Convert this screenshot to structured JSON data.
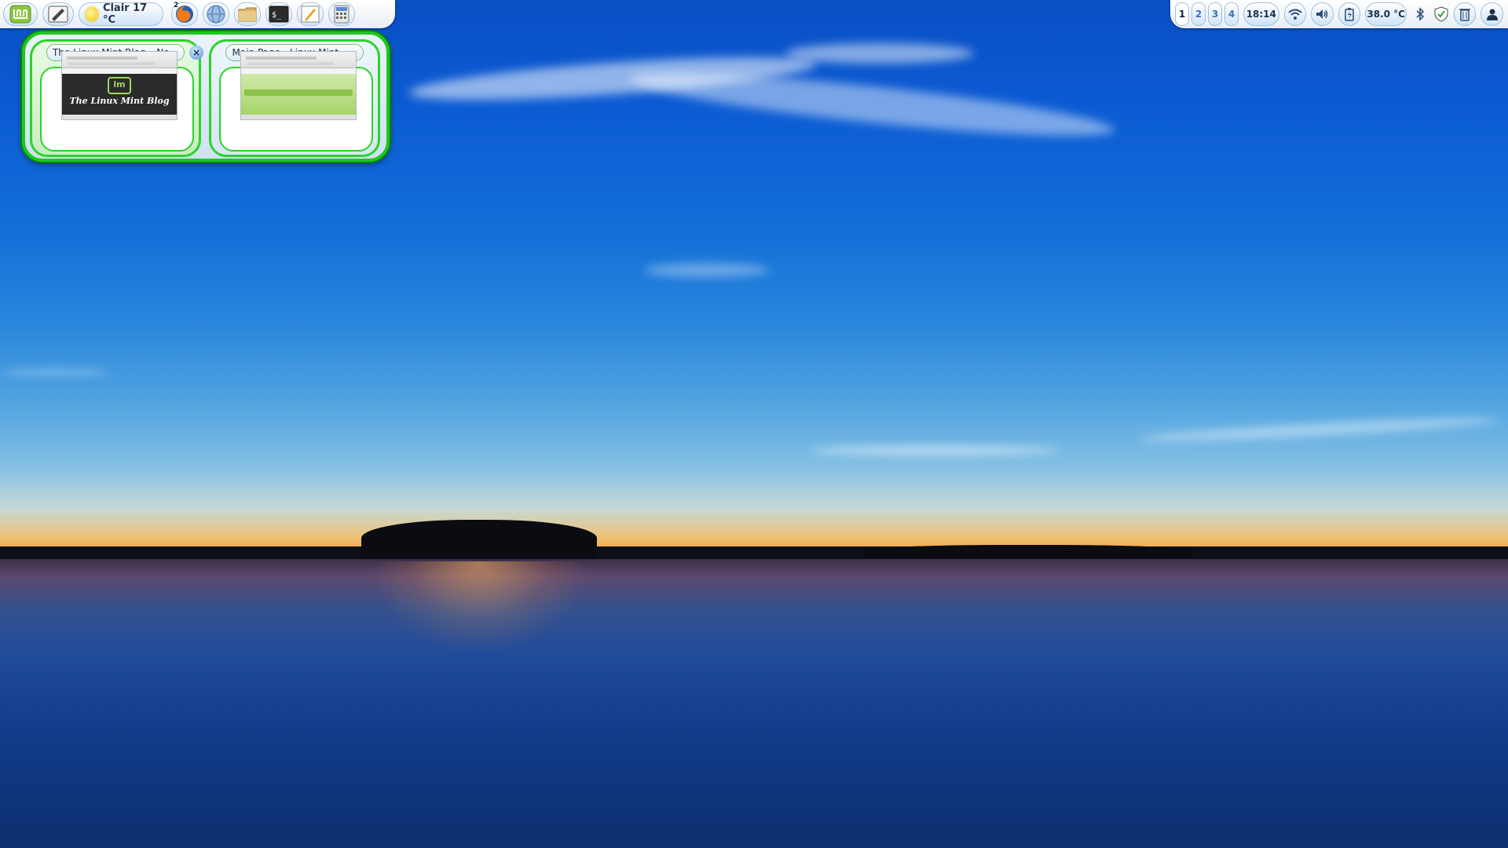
{
  "left_panel": {
    "weather_text": "Clair 17 °C",
    "firefox_badge": "2"
  },
  "window_previews": [
    {
      "title": "The Linux Mint Blog – Ne...",
      "close_glyph": "×",
      "thumbnail_logo_text": "lm",
      "thumbnail_heading": "The Linux Mint Blog"
    },
    {
      "title": "Main Page - Linux Mint - ..."
    }
  ],
  "right_panel": {
    "workspaces": [
      "1",
      "2",
      "3",
      "4"
    ],
    "active_workspace": "1",
    "clock": "18:14",
    "temperature": "38.0 °C",
    "icons": [
      "wifi-icon",
      "volume-icon",
      "battery-icon",
      "bluetooth-icon",
      "shield-icon",
      "trash-icon",
      "user-icon"
    ]
  },
  "colors": {
    "panel_accent": "#9fbfdc",
    "preview_border": "#1cc81a"
  }
}
